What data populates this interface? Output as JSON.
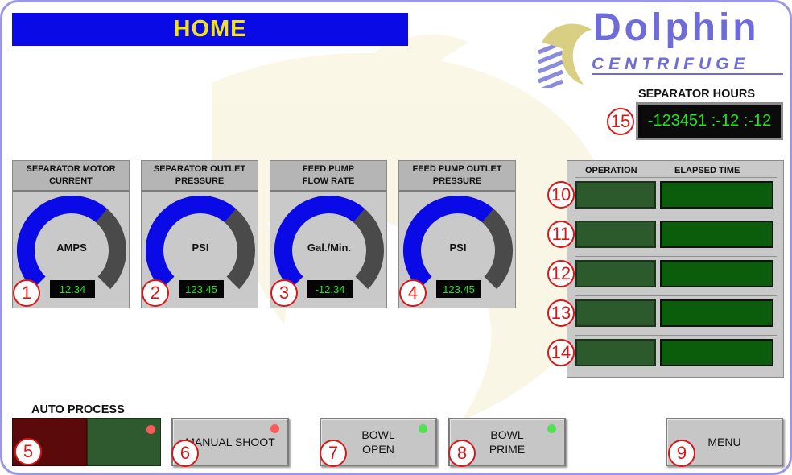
{
  "header": {
    "title": "HOME"
  },
  "logo": {
    "name": "Dolphin",
    "subtitle": "CENTRIFUGE"
  },
  "separator_hours": {
    "label": "SEPARATOR HOURS",
    "value": "-123451 :-12 :-12",
    "badge": "15"
  },
  "gauges": [
    {
      "title_line1": "SEPARATOR MOTOR",
      "title_line2": "CURRENT",
      "unit": "AMPS",
      "value": "12.34",
      "badge": "1",
      "fill_fraction": 0.65
    },
    {
      "title_line1": "SEPARATOR OUTLET",
      "title_line2": "PRESSURE",
      "unit": "PSI",
      "value": "123.45",
      "badge": "2",
      "fill_fraction": 0.65
    },
    {
      "title_line1": "FEED PUMP",
      "title_line2": "FLOW RATE",
      "unit": "Gal./Min.",
      "value": "-12.34",
      "badge": "3",
      "fill_fraction": 0.65
    },
    {
      "title_line1": "FEED PUMP OUTLET",
      "title_line2": "PRESSURE",
      "unit": "PSI",
      "value": "123.45",
      "badge": "4",
      "fill_fraction": 0.65
    }
  ],
  "operations": {
    "header_operation": "OPERATION",
    "header_elapsed": "ELAPSED TIME",
    "badges": [
      "10",
      "11",
      "12",
      "13",
      "14"
    ]
  },
  "auto_process": {
    "label": "AUTO PROCESS",
    "badge": "5"
  },
  "buttons": {
    "manual_shoot": {
      "label": "MANUAL SHOOT",
      "badge": "6"
    },
    "bowl_open": {
      "line1": "BOWL",
      "line2": "OPEN",
      "badge": "7"
    },
    "bowl_prime": {
      "line1": "BOWL",
      "line2": "PRIME",
      "badge": "8"
    },
    "menu": {
      "label": "MENU",
      "badge": "9"
    }
  },
  "colors": {
    "gauge_fill": "#0a0ae6",
    "gauge_track": "#4a4a4a",
    "lamp_red": "#ff5a5a",
    "lamp_green": "#52e052",
    "display_text": "#1de61d"
  },
  "icons": {
    "logo": "dolphin-logo-icon",
    "watermark": "dolphin-watermark-icon",
    "lamp": "status-lamp-icon"
  }
}
